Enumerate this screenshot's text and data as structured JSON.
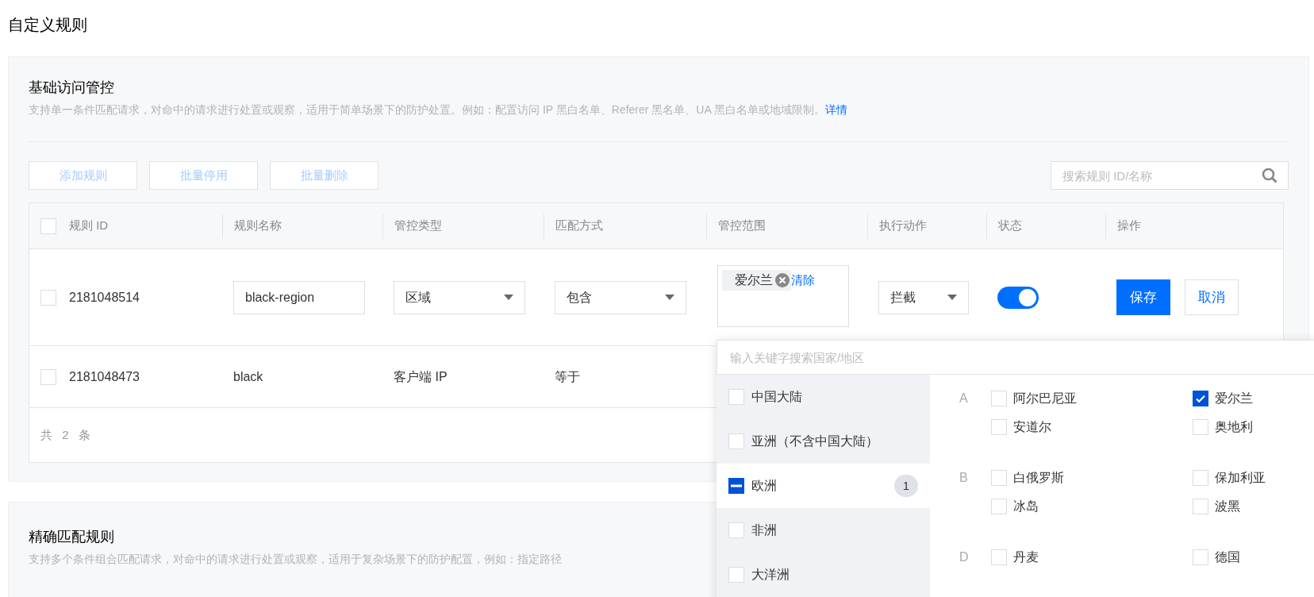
{
  "page_title": "自定义规则",
  "basic_section": {
    "title": "基础访问管控",
    "description": "支持单一条件匹配请求，对命中的请求进行处置或观察，适用于简单场景下的防护处置。例如：配置访问 IP 黑白名单、Referer 黑名单、UA 黑白名单或地域限制。",
    "description_link": "详情",
    "buttons": [
      {
        "label": "添加规则",
        "disabled": true
      },
      {
        "label": "批量停用",
        "disabled": true
      },
      {
        "label": "批量删除",
        "disabled": true
      }
    ],
    "search": {
      "placeholder": "搜索规则 ID/名称"
    },
    "table": {
      "select_all": {
        "checked": false
      },
      "columns": [
        "规则 ID",
        "规则名称",
        "管控类型",
        "匹配方式",
        "管控范围",
        "执行动作",
        "状态",
        "操作"
      ],
      "rows": [
        {
          "kind": "edit",
          "checked": false,
          "id": "2181048514",
          "name": "black-region",
          "type": "区域",
          "match": "包含",
          "scope_tags": [
            {
              "label": "爱尔兰"
            }
          ],
          "scope_clear": "清除",
          "action": "拦截",
          "enabled": true,
          "save": "保存",
          "cancel": "取消"
        },
        {
          "kind": "view",
          "checked": false,
          "id": "2181048473",
          "name": "black",
          "type": "客户端 IP",
          "match": "等于"
        }
      ],
      "footer": "共 2 条"
    }
  },
  "region_dropdown": {
    "placeholder": "输入关键字搜索国家/地区",
    "regions": [
      {
        "label": "中国大陆",
        "checked": false,
        "indeterminate": false,
        "selected": false
      },
      {
        "label": "亚洲（不含中国大陆）",
        "checked": false,
        "indeterminate": false,
        "selected": false
      },
      {
        "label": "欧洲",
        "checked": false,
        "indeterminate": true,
        "selected": true,
        "count": "1"
      },
      {
        "label": "非洲",
        "checked": false,
        "indeterminate": false,
        "selected": false
      },
      {
        "label": "大洋洲",
        "checked": false,
        "indeterminate": false,
        "selected": false
      }
    ],
    "groups": [
      {
        "letter": "A",
        "countries": [
          {
            "name": "阿尔巴尼亚",
            "checked": false
          },
          {
            "name": "爱尔兰",
            "checked": true
          },
          {
            "name": "安道尔",
            "checked": false
          },
          {
            "name": "奥地利",
            "checked": false
          }
        ]
      },
      {
        "letter": "B",
        "countries": [
          {
            "name": "白俄罗斯",
            "checked": false
          },
          {
            "name": "保加利亚",
            "checked": false
          },
          {
            "name": "冰岛",
            "checked": false
          },
          {
            "name": "波黑",
            "checked": false
          }
        ]
      },
      {
        "letter": "D",
        "countries": [
          {
            "name": "丹麦",
            "checked": false
          },
          {
            "name": "德国",
            "checked": false
          }
        ]
      }
    ]
  },
  "precise_section": {
    "title": "精确匹配规则",
    "description": "支持多个条件组合匹配请求，对命中的请求进行处置或观察，适用于复杂场景下的防护配置，例如：指定路径"
  }
}
